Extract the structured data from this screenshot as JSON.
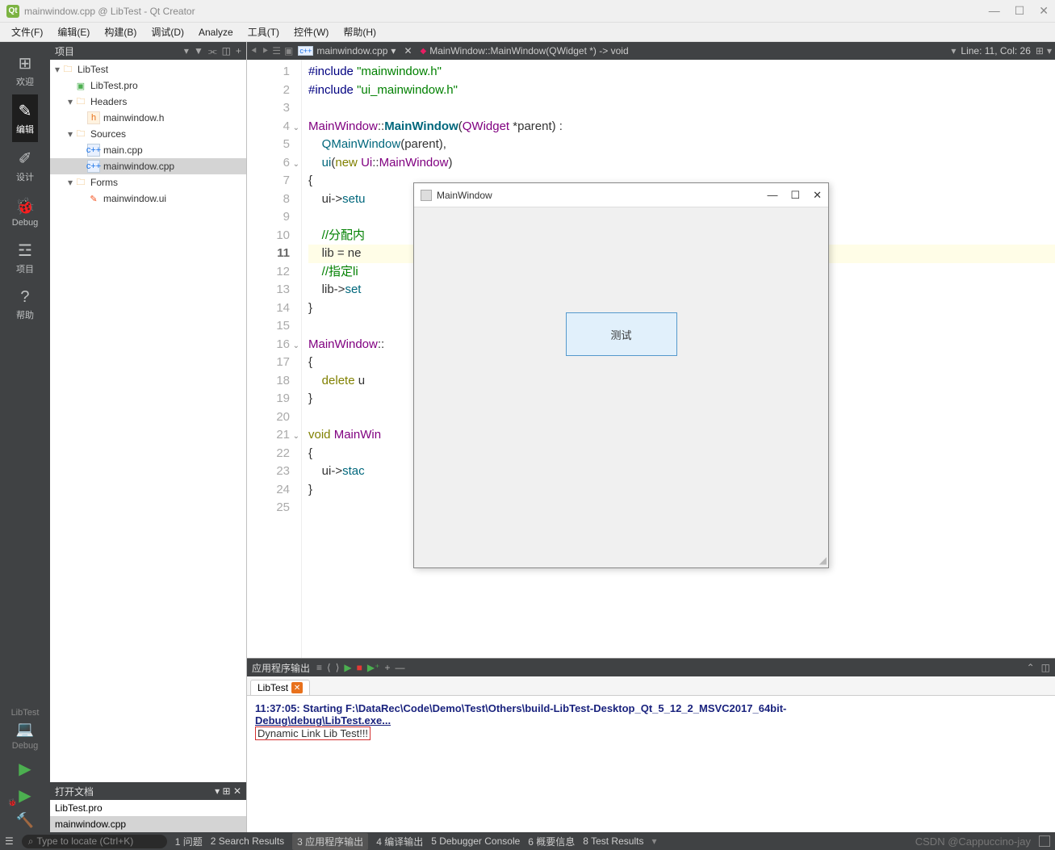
{
  "window": {
    "title": "mainwindow.cpp @ LibTest - Qt Creator",
    "app_icon_text": "Qt"
  },
  "menus": [
    "文件(F)",
    "编辑(E)",
    "构建(B)",
    "调试(D)",
    "Analyze",
    "工具(T)",
    "控件(W)",
    "帮助(H)"
  ],
  "iconbar": {
    "items": [
      {
        "icon": "⊞",
        "label": "欢迎"
      },
      {
        "icon": "✎",
        "label": "编辑",
        "active": true
      },
      {
        "icon": "✐",
        "label": "设计"
      },
      {
        "icon": "🐞",
        "label": "Debug"
      },
      {
        "icon": "☲",
        "label": "项目"
      },
      {
        "icon": "?",
        "label": "帮助"
      }
    ],
    "bottom": {
      "project": "LibTest",
      "config_icon": "💻",
      "config": "Debug"
    }
  },
  "sidepanel": {
    "header": "项目",
    "tree": {
      "root": "LibTest",
      "pro": "LibTest.pro",
      "headers_label": "Headers",
      "headers": [
        "mainwindow.h"
      ],
      "sources_label": "Sources",
      "sources": [
        "main.cpp",
        "mainwindow.cpp"
      ],
      "forms_label": "Forms",
      "forms": [
        "mainwindow.ui"
      ]
    },
    "open_header": "打开文档",
    "open_docs": [
      "LibTest.pro",
      "mainwindow.cpp"
    ]
  },
  "editor": {
    "file": "mainwindow.cpp",
    "function": "MainWindow::MainWindow(QWidget *) -> void",
    "position": "Line: 11, Col: 26",
    "lines": [
      {
        "n": 1,
        "html": "<span class='pp'>#include</span> <span class='str'>\"mainwindow.h\"</span>"
      },
      {
        "n": 2,
        "html": "<span class='pp'>#include</span> <span class='str'>\"ui_mainwindow.h\"</span>"
      },
      {
        "n": 3,
        "html": ""
      },
      {
        "n": 4,
        "fold": true,
        "html": "<span class='cls'>MainWindow</span>::<span class='func bold'>MainWindow</span>(<span class='cls'>QWidget</span> *parent) :"
      },
      {
        "n": 5,
        "html": "    <span class='func'>QMainWindow</span>(parent),"
      },
      {
        "n": 6,
        "fold": true,
        "html": "    <span class='func'>ui</span>(<span class='kw'>new</span> <span class='cls'>Ui</span>::<span class='cls'>MainWindow</span>)"
      },
      {
        "n": 7,
        "html": "{"
      },
      {
        "n": 8,
        "html": "    ui-&gt;<span class='func'>setu</span>"
      },
      {
        "n": 9,
        "html": ""
      },
      {
        "n": 10,
        "html": "    <span class='cmt'>//分配内</span>"
      },
      {
        "n": 11,
        "cur": true,
        "html": "    lib = ne"
      },
      {
        "n": 12,
        "html": "    <span class='cmt'>//指定li                                             get的第二页</span>"
      },
      {
        "n": 13,
        "html": "    lib-&gt;<span class='func'>set</span>"
      },
      {
        "n": 14,
        "html": "}"
      },
      {
        "n": 15,
        "html": ""
      },
      {
        "n": 16,
        "fold": true,
        "html": "<span class='cls'>MainWindow</span>::"
      },
      {
        "n": 17,
        "html": "{"
      },
      {
        "n": 18,
        "html": "    <span class='kw'>delete</span> u"
      },
      {
        "n": 19,
        "html": "}"
      },
      {
        "n": 20,
        "html": ""
      },
      {
        "n": 21,
        "fold": true,
        "html": "<span class='kw'>void</span> <span class='cls'>MainWin</span>"
      },
      {
        "n": 22,
        "html": "{"
      },
      {
        "n": 23,
        "html": "    ui-&gt;<span class='func'>stac</span>"
      },
      {
        "n": 24,
        "html": "}"
      },
      {
        "n": 25,
        "html": ""
      }
    ]
  },
  "app_window": {
    "title": "MainWindow",
    "button": "测试"
  },
  "output": {
    "header": "应用程序输出",
    "tab": "LibTest",
    "start_line1": "11:37:05: Starting F:\\DataRec\\Code\\Demo\\Test\\Others\\build-LibTest-Desktop_Qt_5_12_2_MSVC2017_64bit-",
    "start_line2": "Debug\\debug\\LibTest.exe...",
    "dyn_line": "Dynamic Link Lib Test!!!"
  },
  "statusbar": {
    "search_placeholder": "Type to locate (Ctrl+K)",
    "items": [
      "1 问题",
      "2 Search Results",
      "3 应用程序输出",
      "4 编译输出",
      "5 Debugger Console",
      "6 概要信息",
      "8 Test Results"
    ],
    "active_index": 2,
    "watermark": "CSDN @Cappuccino-jay"
  }
}
